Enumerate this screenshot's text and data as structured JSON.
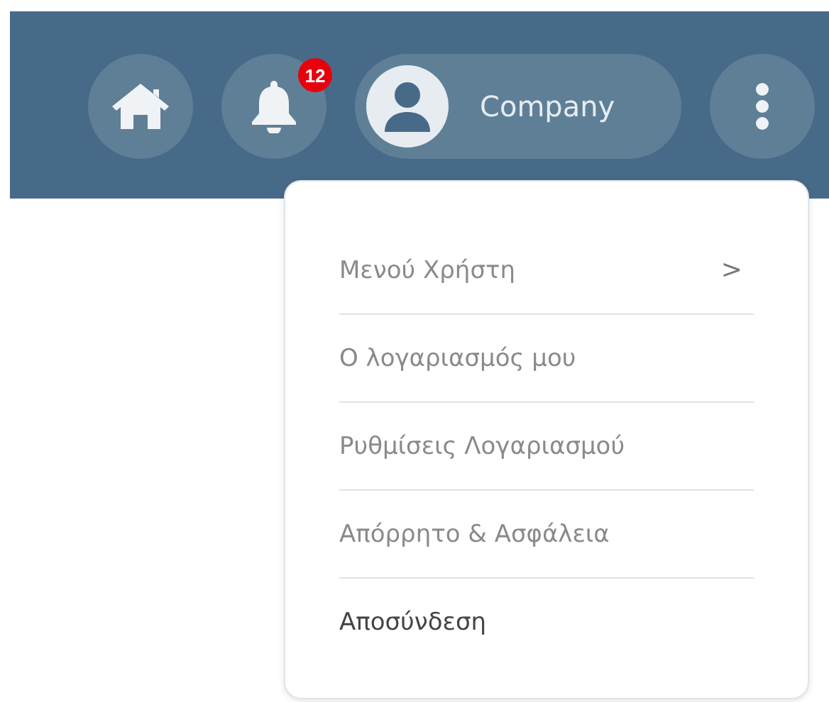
{
  "header": {
    "notifications": {
      "count": "12"
    },
    "account": {
      "label": "Company"
    }
  },
  "user_menu": {
    "items": [
      {
        "label": "Μενού Χρήστη",
        "kind": "submenu",
        "chevron": ">"
      },
      {
        "label": "Ο λογαριασμός μου",
        "kind": "link"
      },
      {
        "label": "Ρυθμίσεις Λογαριασμού",
        "kind": "link"
      },
      {
        "label": "Απόρρητο & Ασφάλεια",
        "kind": "link"
      },
      {
        "label": "Αποσύνδεση",
        "kind": "action"
      }
    ]
  }
}
